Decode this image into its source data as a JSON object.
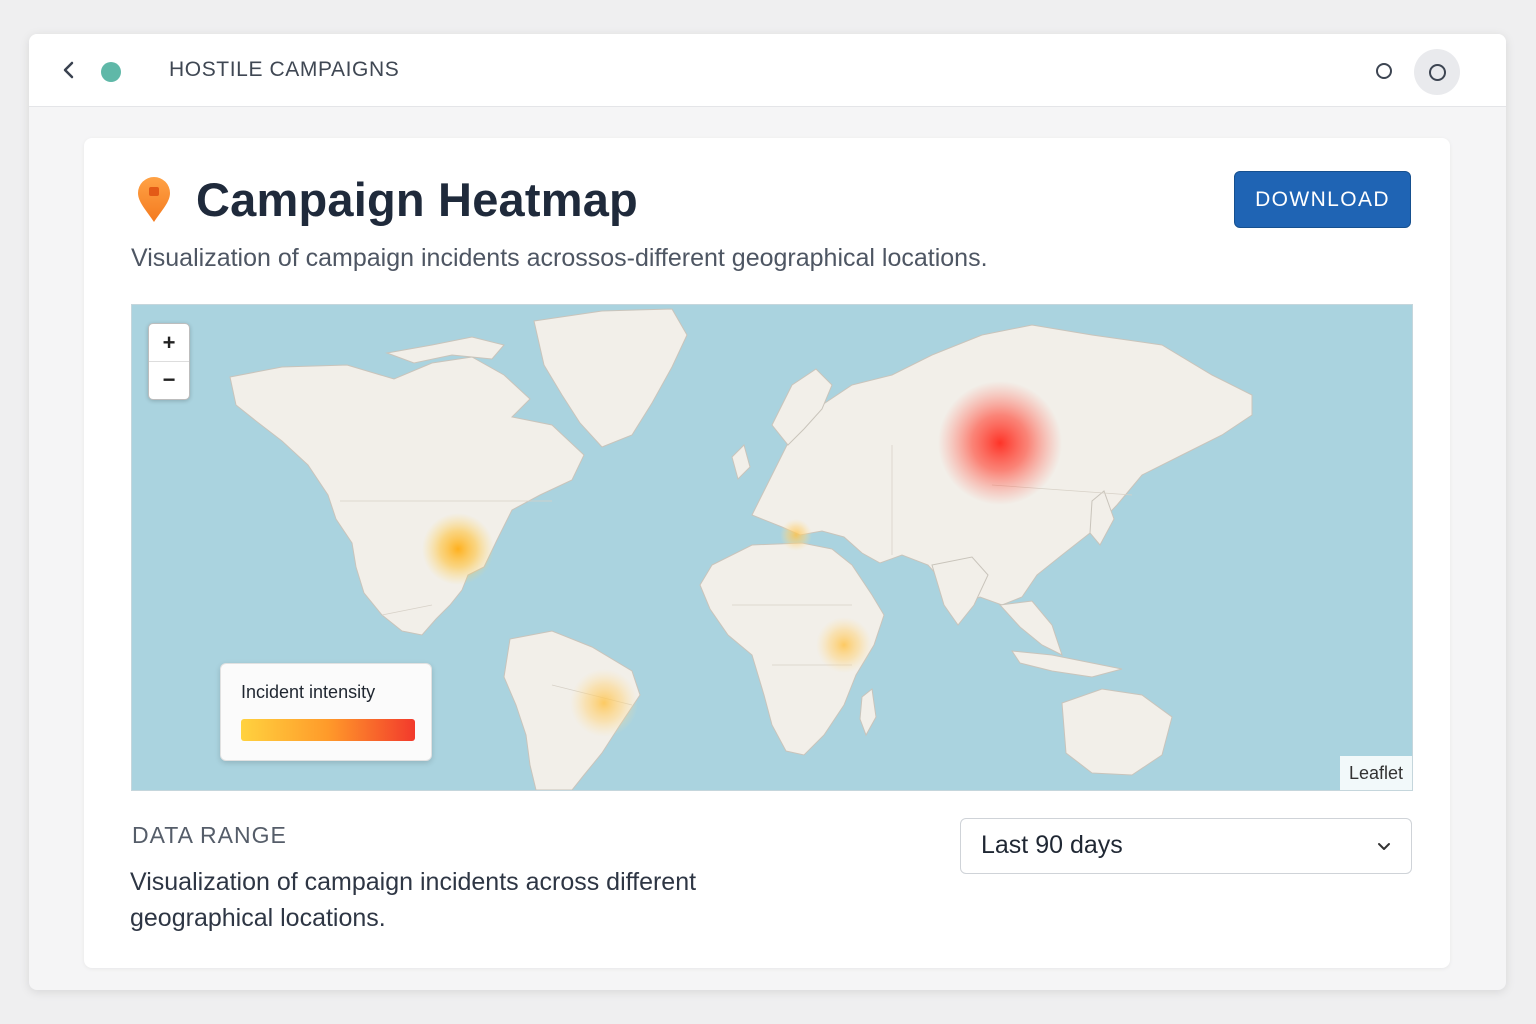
{
  "header": {
    "app_title": "HOSTILE CAMPAIGNS",
    "status_dot_color": "#5fb8a8",
    "icons": [
      "chevron-left-icon",
      "status-dot",
      "ring-icon",
      "ring-icon"
    ]
  },
  "card": {
    "title": "Campaign Heatmap",
    "title_icon": "map-pin-icon",
    "download_label": "DOWNLOAD",
    "accent_color": "#1f64b4",
    "subtitle": "Visualization of campaign incidents acrossos-different geographical locations."
  },
  "map": {
    "zoom_in_label": "+",
    "zoom_out_label": "−",
    "attribution": "Leaflet",
    "legend": {
      "title": "Incident intensity",
      "gradient": [
        "#ffd23f",
        "#ff9a2a",
        "#f23a2c"
      ]
    },
    "hotspots": [
      {
        "region": "Russia (Siberia)",
        "intensity": "high"
      },
      {
        "region": "United States (south)",
        "intensity": "medium"
      },
      {
        "region": "Brazil",
        "intensity": "low"
      },
      {
        "region": "Horn of Africa",
        "intensity": "low"
      },
      {
        "region": "Greece / Aegean",
        "intensity": "low"
      }
    ]
  },
  "filters": {
    "range_label": "DATA RANGE",
    "range_description": "Visualization of campaign incidents across different geographical locations.",
    "range_value": "Last 90 days",
    "range_chevron_icon": "chevron-down-icon"
  }
}
